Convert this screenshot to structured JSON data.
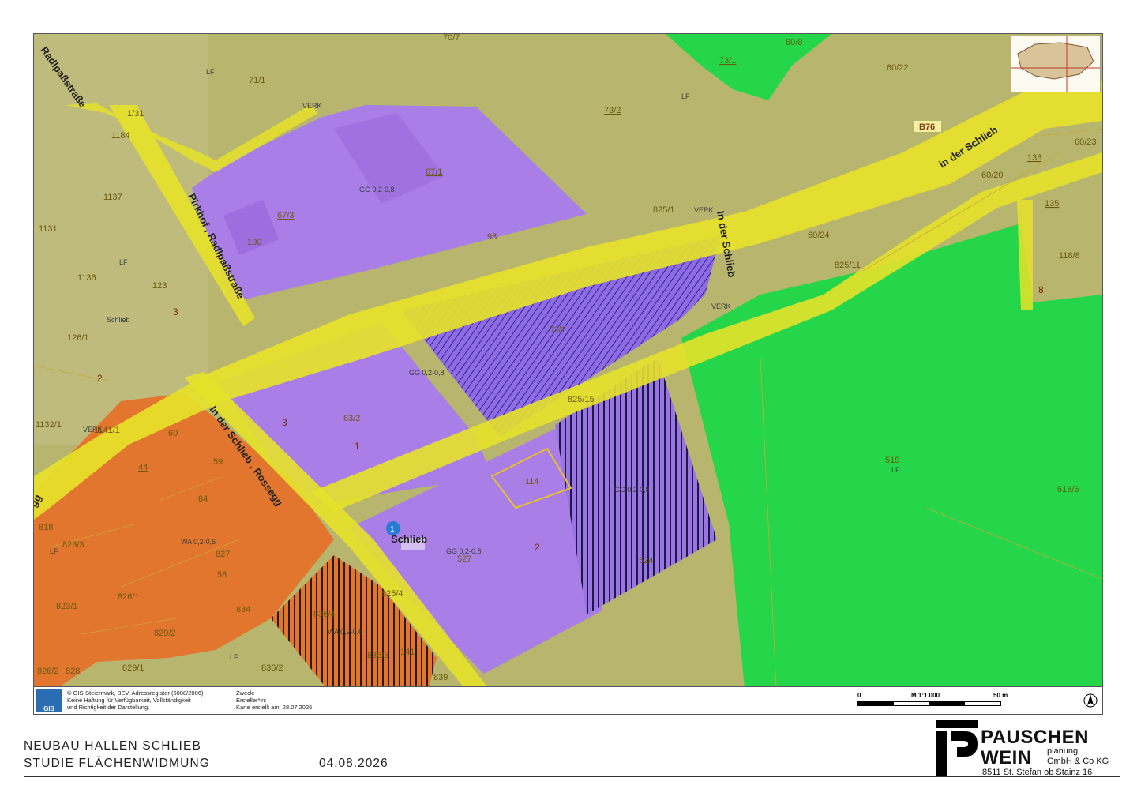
{
  "map": {
    "road_label": "B76",
    "streets": {
      "radlpass_1": "Radlpaßstraße",
      "radlpass_2": "Pirkhof , Radlpaßstraße",
      "schlieb_1": "in der Schlieb",
      "schlieb_2": "In der Schlieb",
      "schlieb_3": "In der Schlieb , Rossegg",
      "place": "Schlieb",
      "place_marker": "Schlieb",
      "marker_number": "1",
      "edge_fragment": "gg"
    },
    "zoning": {
      "gg_1": "GG 0,2-0,8",
      "gg_2": "GG 0,2-0,8",
      "gg_3": "GG 0,2-0,8",
      "gg_4": "GG 0,2-0,8",
      "wa_1": "WA 0,2-0,6",
      "wa_2": "WA 0,2-0,6",
      "lf": "LF",
      "verk": "VERK"
    },
    "parcels": {
      "p71_1": "71/1",
      "p73_1": "73/1",
      "p60_8": "60/8",
      "p60_22": "60/22",
      "p73_2": "73/2",
      "p70_7": "70/7",
      "p1184": "1184",
      "p1137": "1137",
      "p1131": "1131",
      "p1136": "1136",
      "p123": "123",
      "p126_1": "126/1",
      "p67_3": "67/3",
      "p67_1": "67/1",
      "p100": "100",
      "p98": "98",
      "p825_1": "825/1",
      "p60_24": "60/24",
      "p825_11": "825/11",
      "p60_20": "60/20",
      "p60_23": "60/23",
      "p133": "133",
      "p135": "135",
      "p118_8": "118/8",
      "p63_1": "63/1",
      "p63_2": "63/2",
      "p825_15": "825/15",
      "p519": "519",
      "p518_6": "518/6",
      "p114": "114",
      "p527": "527",
      "p524": "524",
      "p60": "60",
      "p44": "44",
      "p59": "59",
      "p84": "84",
      "p827": "827",
      "p58": "58",
      "p834": "834",
      "p836_4": "836/4",
      "p836_3": "836/3",
      "p141": "141",
      "p836_2": "836/2",
      "p839": "839",
      "p826_1": "826/1",
      "p823_1": "823/1",
      "p823_3": "823/3",
      "p829_2": "829/2",
      "p829_1": "829/1",
      "p828": "828",
      "p818": "818",
      "p1132_1": "1132/1",
      "p1141_1": "1141/1",
      "p2": "2",
      "p3": "3",
      "p1": "1",
      "p8": "8",
      "p826_2": "826/2",
      "p825_4": "825/4",
      "p1_31": "1/31"
    }
  },
  "info_bar": {
    "credit_1": "© GIS-Steiermark, BEV, Adressregister (6008/2006)",
    "credit_2": "Keine Haftung für Verfügbarkeit, Vollständigkeit",
    "credit_3": "und Richtigkeit der Darstellung.",
    "purpose": "Zweck:",
    "author": "Ersteller*in:",
    "created": "Karte erstellt am: 28.07.2026",
    "gis_logo": "GIS",
    "scale_zero": "0",
    "scale_label": "M 1:1.000",
    "scale_end": "50 m",
    "north": "N"
  },
  "title": {
    "line1": "NEUBAU HALLEN SCHLIEB",
    "line2": "STUDIE FLÄCHENWIDMUNG",
    "date": "04.08.2026"
  },
  "company": {
    "name1": "PAUSCHEN",
    "name2": "WEIN",
    "sub1": "planung",
    "sub2": "GmbH & Co KG",
    "address": "8511 St. Stefan ob Stainz 16"
  },
  "colors": {
    "agricultural": "#b8b56e",
    "industrial": "#a97ee6",
    "residential": "#e3762e",
    "forest": "#25d64a",
    "traffic": "#e6e22a"
  }
}
